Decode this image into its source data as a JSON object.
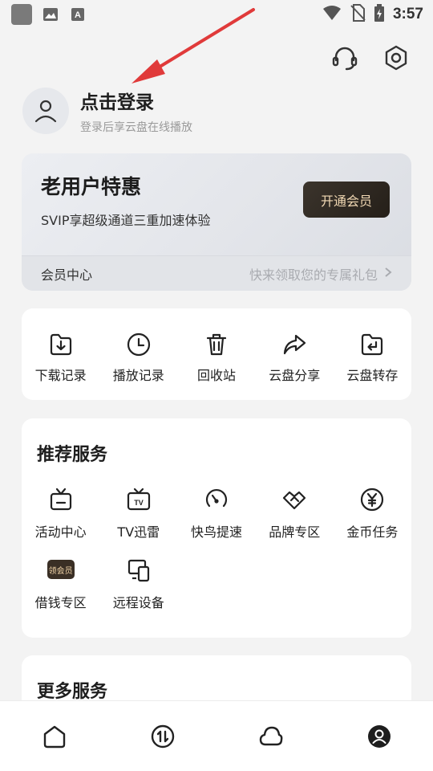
{
  "status_bar": {
    "time": "3:57",
    "left_icons": [
      "app-icon",
      "image-icon",
      "font-icon"
    ],
    "right_icons": [
      "wifi-icon",
      "no-sim-icon",
      "battery-icon"
    ]
  },
  "header": {
    "icons": [
      "headset-icon",
      "settings-icon"
    ]
  },
  "profile": {
    "title": "点击登录",
    "subtitle": "登录后享云盘在线播放"
  },
  "vip_card": {
    "title": "老用户特惠",
    "description": "SVIP享超级通道三重加速体验",
    "button_label": "开通会员",
    "footer_left": "会员中心",
    "footer_right": "快来领取您的专属礼包"
  },
  "quick_actions": [
    {
      "label": "下载记录",
      "icon": "download-folder-icon"
    },
    {
      "label": "播放记录",
      "icon": "clock-icon"
    },
    {
      "label": "回收站",
      "icon": "trash-icon"
    },
    {
      "label": "云盘分享",
      "icon": "share-icon"
    },
    {
      "label": "云盘转存",
      "icon": "transfer-folder-icon"
    }
  ],
  "recommended": {
    "title": "推荐服务",
    "items": [
      {
        "label": "活动中心",
        "icon": "tv-box-icon"
      },
      {
        "label": "TV迅雷",
        "icon": "tv-icon"
      },
      {
        "label": "快鸟提速",
        "icon": "speedometer-icon"
      },
      {
        "label": "品牌专区",
        "icon": "handshake-icon"
      },
      {
        "label": "金币任务",
        "icon": "coin-icon"
      },
      {
        "label": "借钱专区",
        "icon": "member-badge-icon",
        "badge_text": "领会员"
      },
      {
        "label": "远程设备",
        "icon": "remote-device-icon"
      }
    ]
  },
  "more_services": {
    "title": "更多服务"
  },
  "tab_bar": {
    "tabs": [
      "home-icon",
      "transfer-icon",
      "cloud-icon",
      "profile-icon"
    ]
  },
  "colors": {
    "accent_dark": "#2a231d",
    "gold_text": "#f2d9b4",
    "arrow": "#e03a3a"
  }
}
